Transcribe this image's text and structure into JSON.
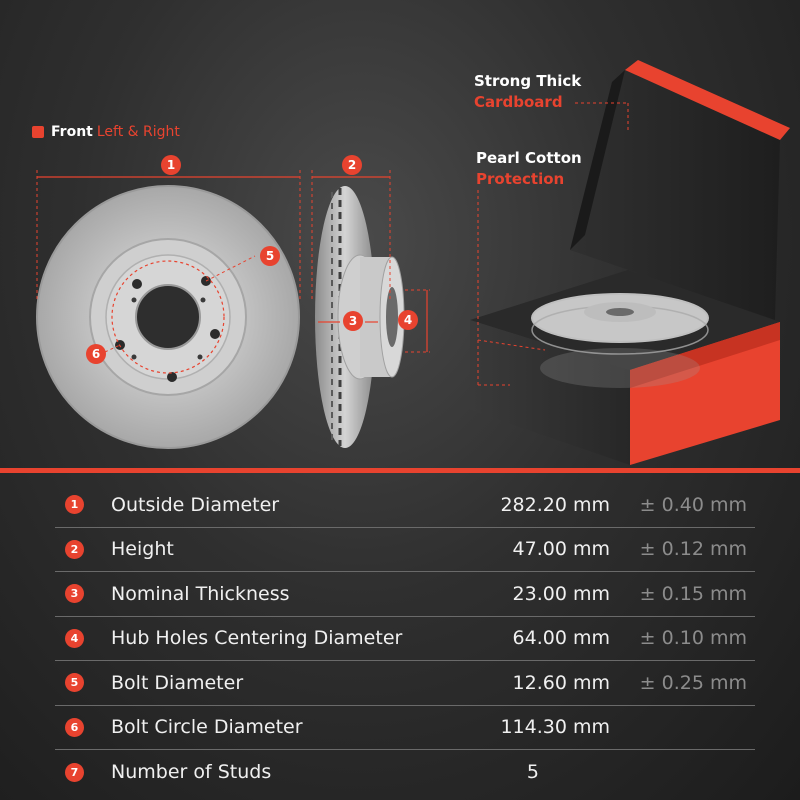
{
  "header": {
    "front_label": "Front",
    "front_sub": "Left & Right"
  },
  "callouts": {
    "cardboard_line1": "Strong Thick",
    "cardboard_line2": "Cardboard",
    "cotton_line1": "Pearl Cotton",
    "cotton_line2": "Protection"
  },
  "badges": [
    "1",
    "2",
    "3",
    "4",
    "5",
    "6"
  ],
  "colors": {
    "accent": "#e8432f",
    "background": "#2f2f2f",
    "tolerance": "#8c8c8c"
  },
  "specs": [
    {
      "num": "1",
      "name": "Outside Diameter",
      "value": "282.20 mm",
      "tolerance": "± 0.40 mm"
    },
    {
      "num": "2",
      "name": "Height",
      "value": "47.00 mm",
      "tolerance": "± 0.12 mm"
    },
    {
      "num": "3",
      "name": "Nominal Thickness",
      "value": "23.00 mm",
      "tolerance": "± 0.15 mm"
    },
    {
      "num": "4",
      "name": "Hub Holes Centering Diameter",
      "value": "64.00 mm",
      "tolerance": "± 0.10 mm"
    },
    {
      "num": "5",
      "name": "Bolt Diameter",
      "value": "12.60 mm",
      "tolerance": "± 0.25 mm"
    },
    {
      "num": "6",
      "name": "Bolt Circle Diameter",
      "value": "114.30 mm",
      "tolerance": ""
    },
    {
      "num": "7",
      "name": "Number of Studs",
      "value": "5",
      "tolerance": ""
    }
  ]
}
